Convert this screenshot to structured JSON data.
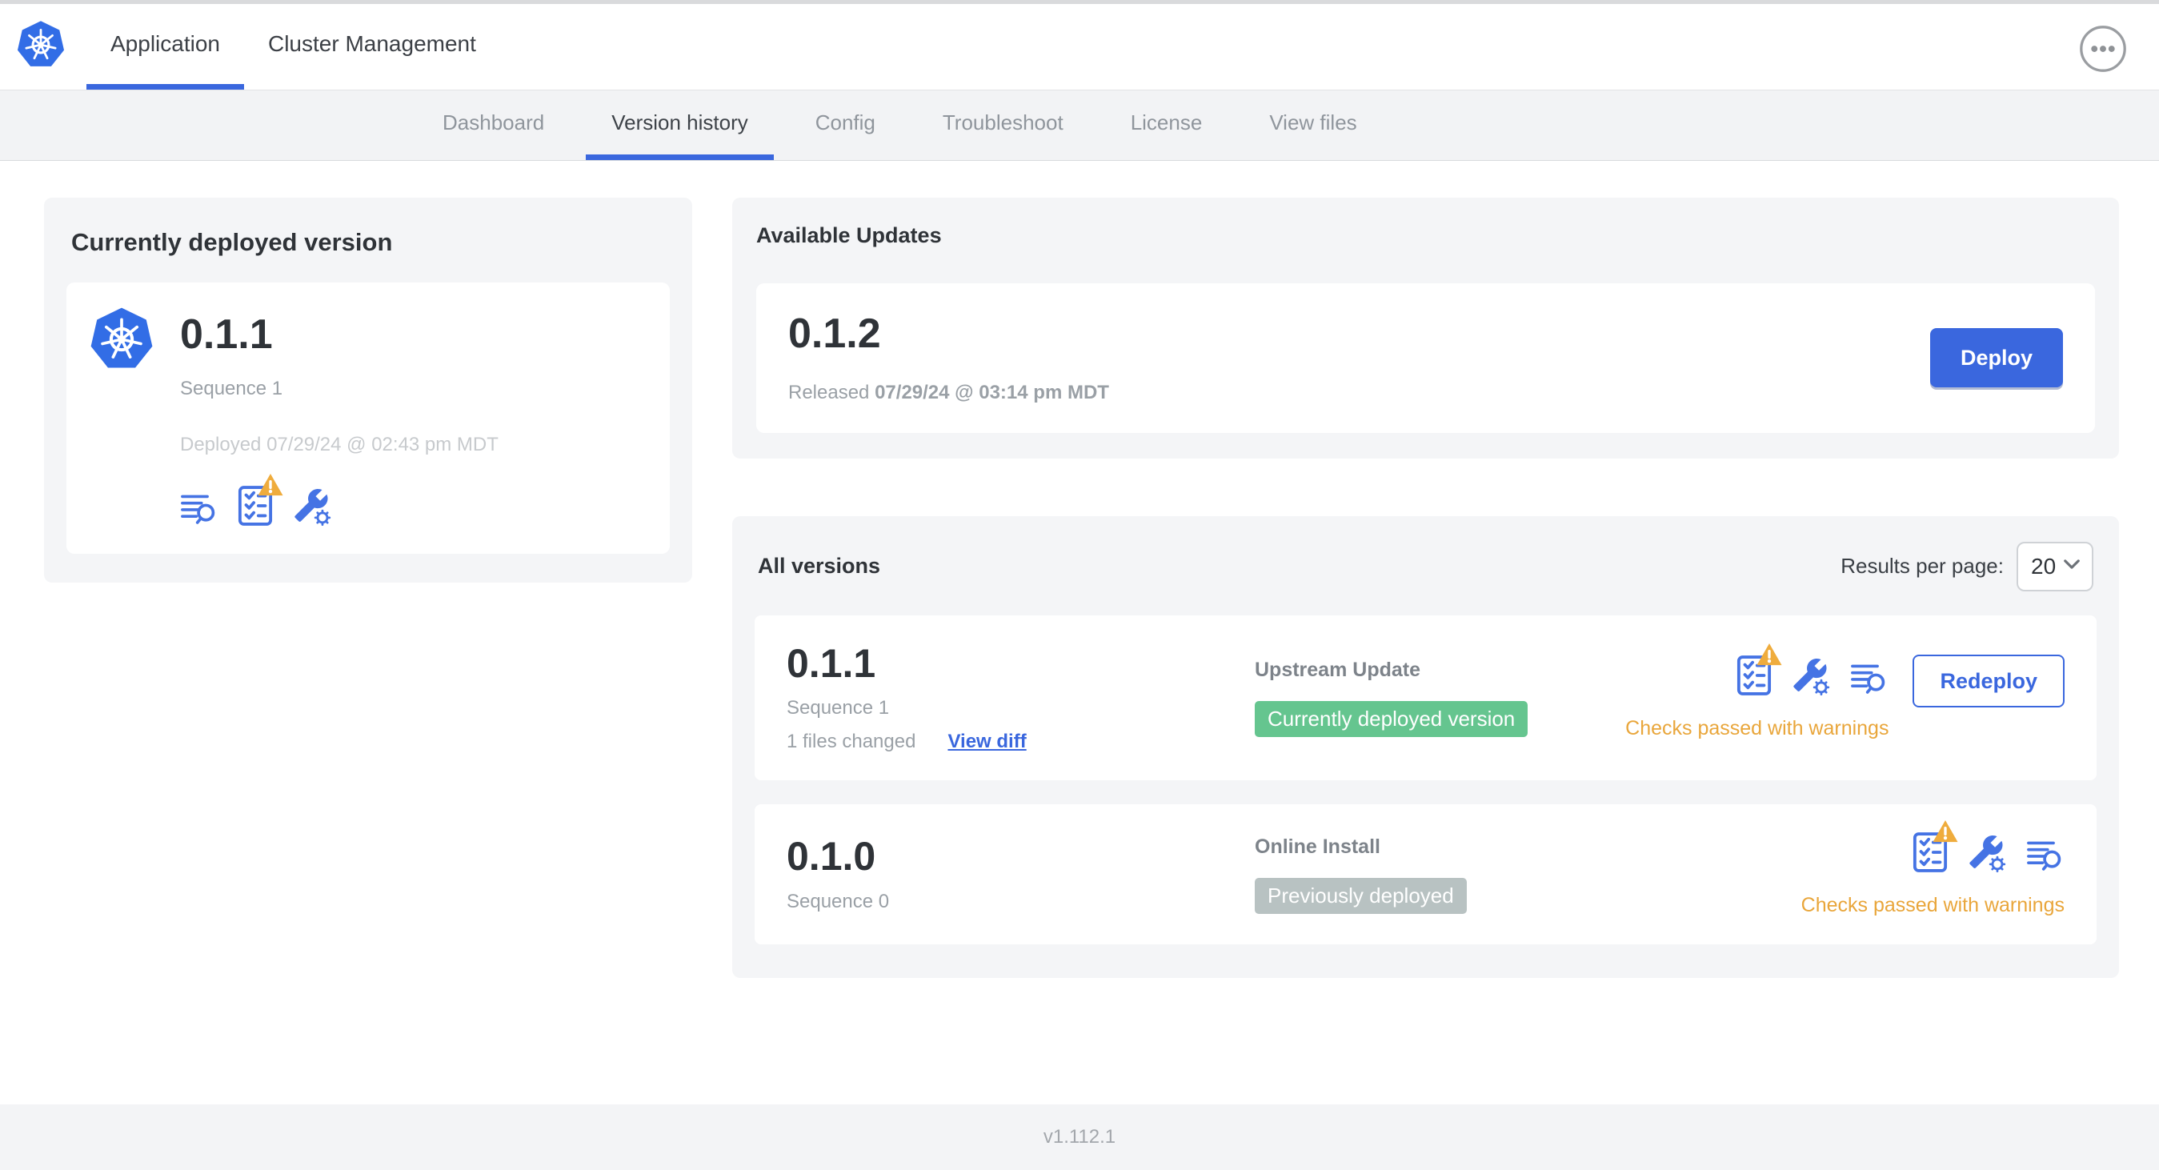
{
  "header": {
    "logo": "kubernetes-logo",
    "tabs": [
      {
        "label": "Application"
      },
      {
        "label": "Cluster Management"
      }
    ],
    "active_tab": "Application",
    "overflow_menu": "ellipsis-icon"
  },
  "subnav": {
    "tabs": [
      {
        "label": "Dashboard"
      },
      {
        "label": "Version history"
      },
      {
        "label": "Config"
      },
      {
        "label": "Troubleshoot"
      },
      {
        "label": "License"
      },
      {
        "label": "View files"
      }
    ],
    "active_tab": "Version history"
  },
  "current_version": {
    "title": "Currently deployed version",
    "version": "0.1.1",
    "sequence": "Sequence 1",
    "deployed_prefix": "Deployed",
    "deployed_at": "07/29/24 @ 02:43 pm MDT",
    "icons": [
      "release-notes-icon",
      "preflight-checks-icon",
      "config-icon"
    ]
  },
  "available_updates": {
    "title": "Available Updates",
    "version": "0.1.2",
    "released_prefix": "Released",
    "released_at": "07/29/24 @ 03:14 pm MDT",
    "deploy_label": "Deploy"
  },
  "all_versions": {
    "title": "All versions",
    "results_per_page_label": "Results per page:",
    "results_per_page_value": "20",
    "rows": [
      {
        "version": "0.1.1",
        "sequence": "Sequence 1",
        "files_changed": "1 files changed",
        "view_diff_label": "View diff",
        "source": "Upstream Update",
        "badge": "Currently deployed version",
        "badge_color": "#65c58f",
        "action_label": "Redeploy",
        "status": "Checks passed with warnings",
        "icons": [
          "preflight-checks-icon",
          "config-icon",
          "release-notes-icon"
        ]
      },
      {
        "version": "0.1.0",
        "sequence": "Sequence 0",
        "source": "Online Install",
        "badge": "Previously deployed",
        "badge_color": "#b8c2c2",
        "status": "Checks passed with warnings",
        "icons": [
          "preflight-checks-icon",
          "config-icon",
          "release-notes-icon"
        ]
      }
    ]
  },
  "footer": {
    "app_version": "v1.112.1"
  },
  "colors": {
    "accent_blue": "#3a67de",
    "icon_blue": "#4573e4",
    "success_green": "#65c58f",
    "badge_gray": "#b8c2c2",
    "warning_amber": "#e9a63b",
    "panel_gray": "#f4f5f7",
    "logo_blue": "#326de6"
  }
}
